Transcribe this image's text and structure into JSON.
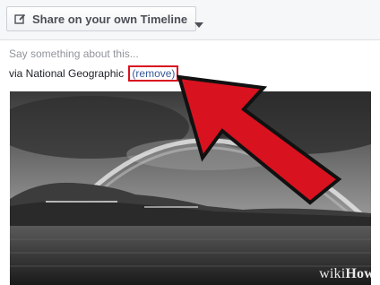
{
  "share_bar": {
    "button_label": "Share on your own Timeline",
    "edit_icon": "pencil-edit-icon",
    "dropdown_icon": "chevron-down-icon"
  },
  "composer": {
    "placeholder": "Say something about this..."
  },
  "attribution": {
    "via_text": "via National Geographic",
    "remove_label": "(remove)",
    "highlight_color": "#d9121f"
  },
  "preview": {
    "description": "black-and-white photo of a rainbow arcing over a lake and hills"
  },
  "annotation": {
    "arrow_color": "#d9121f",
    "arrow_outline": "#111111"
  },
  "watermark": {
    "wiki": "wiki",
    "how": "How"
  }
}
